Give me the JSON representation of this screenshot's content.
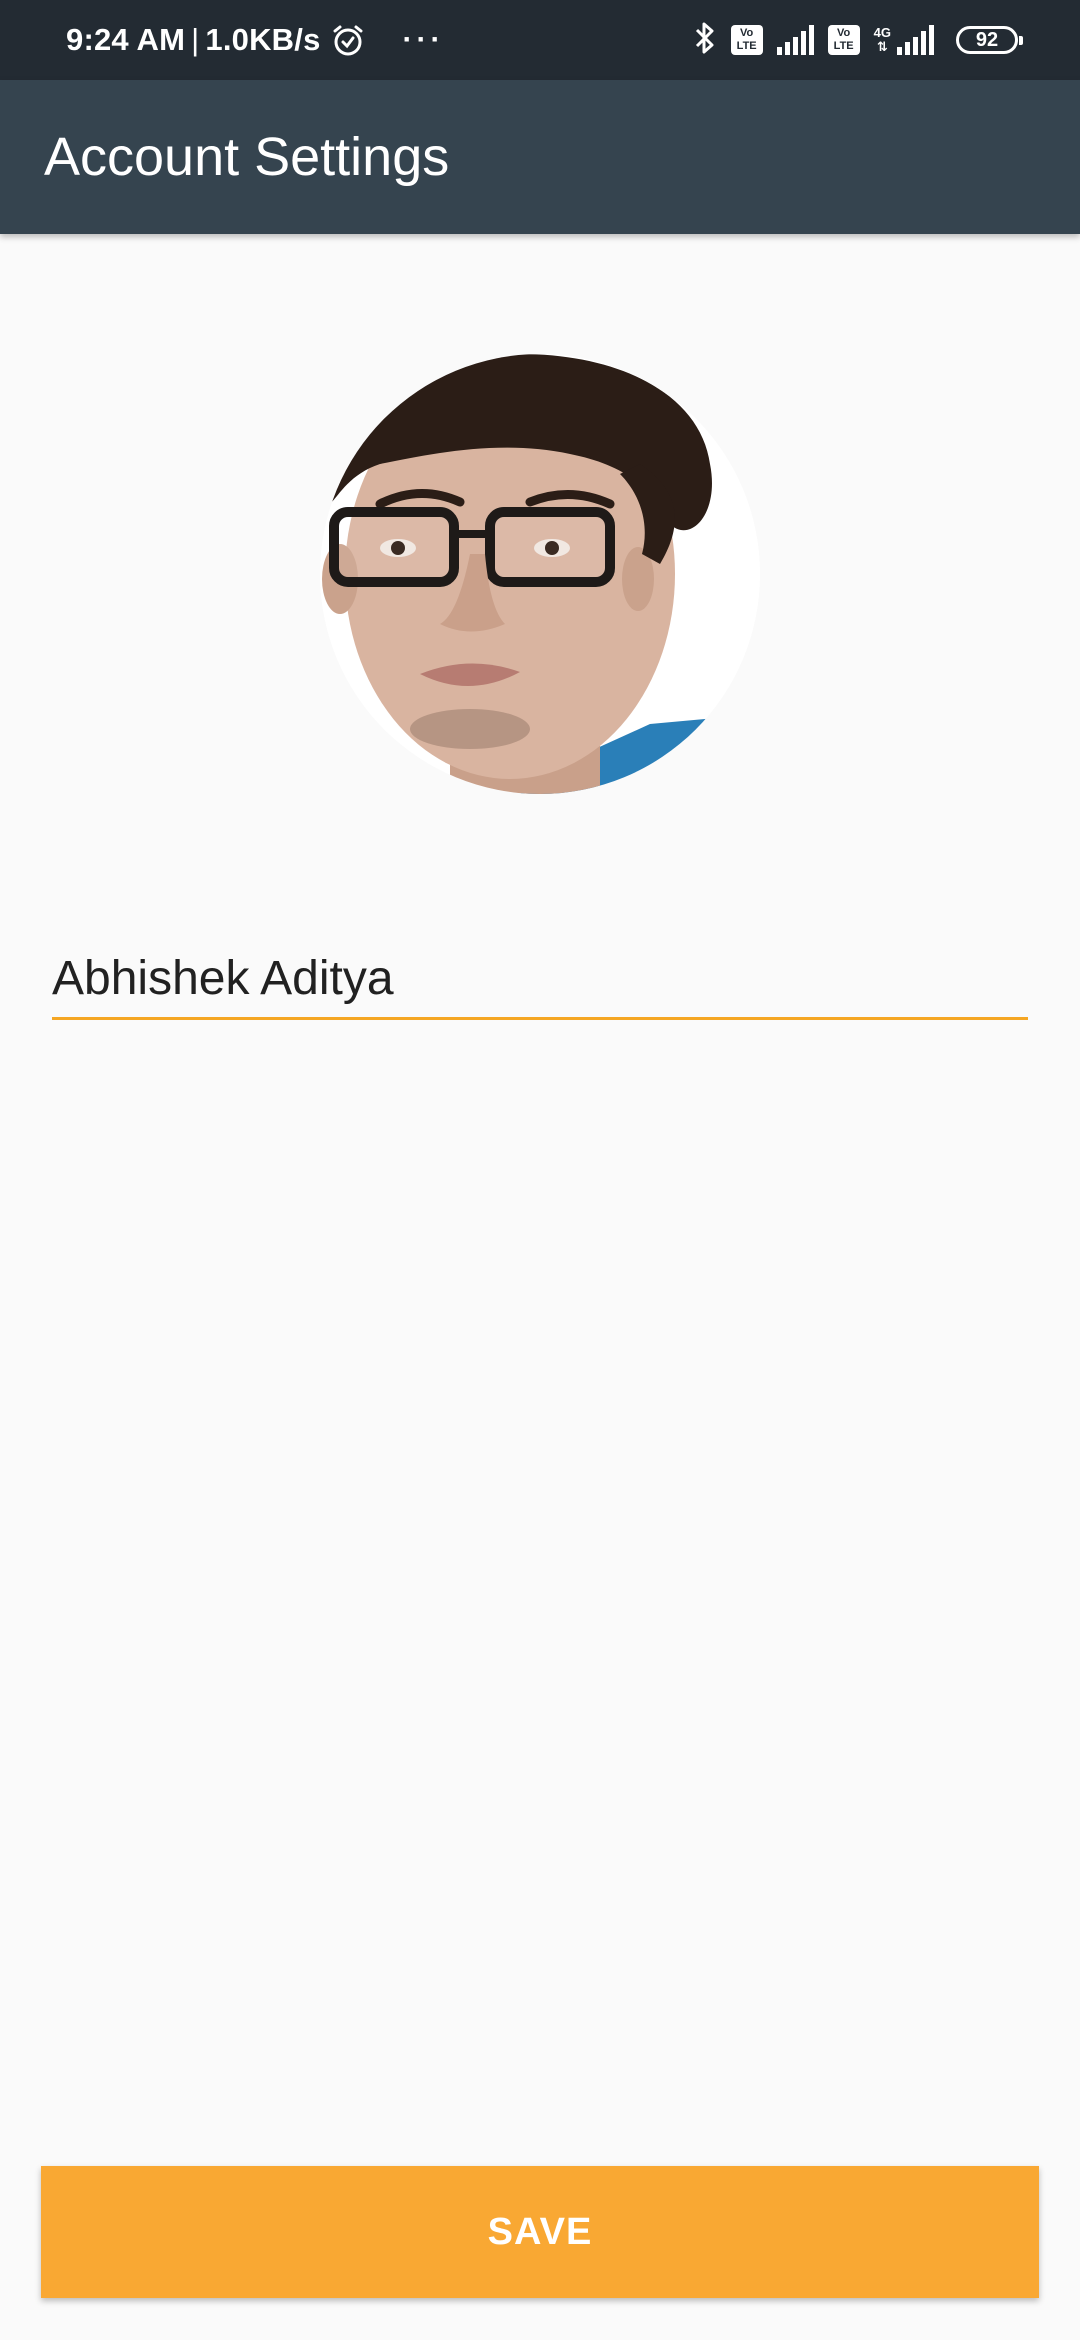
{
  "status_bar": {
    "time": "9:24 AM",
    "separator": "|",
    "speed": "1.0KB/s",
    "more": "···",
    "volte_1": "Vo LTE",
    "volte_2": "Vo LTE",
    "network": "4G",
    "battery": "92",
    "icons": [
      "alarm-icon",
      "bluetooth-icon",
      "volte-icon",
      "signal-icon",
      "volte-icon",
      "signal-icon",
      "battery-icon"
    ]
  },
  "app_bar": {
    "title": "Account Settings",
    "background": "#35444f"
  },
  "profile": {
    "avatar": "profile-photo"
  },
  "form": {
    "name_value": "Abhishek Aditya",
    "underline_color": "#f5a623"
  },
  "actions": {
    "save_label": "SAVE",
    "save_color": "#f9a833"
  }
}
